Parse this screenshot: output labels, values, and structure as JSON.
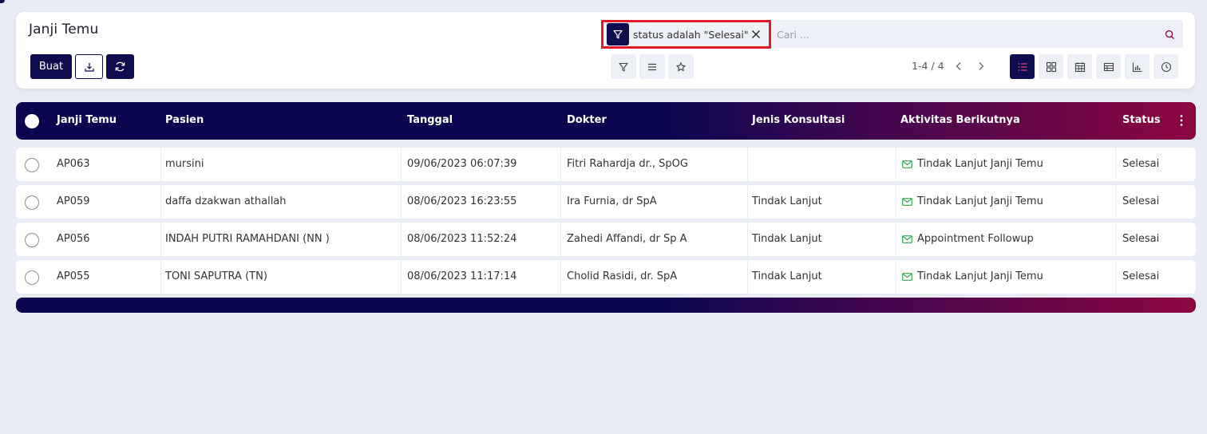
{
  "colors": {
    "primary": "#0e0b4f",
    "accent_end": "#8c0640",
    "highlight": "#e01b24",
    "activity_icon": "#2fa84f",
    "background": "#e9ebf5"
  },
  "header": {
    "title": "Janji Temu",
    "create_label": "Buat",
    "download_icon": "download-icon",
    "refresh_icon": "refresh-icon"
  },
  "search": {
    "facet_label": "status adalah \"Selesai\"",
    "placeholder": "Cari ..."
  },
  "pager": {
    "value": "1-4 / 4"
  },
  "table": {
    "columns": [
      "Janji Temu",
      "Pasien",
      "Tanggal",
      "Dokter",
      "Jenis Konsultasi",
      "Aktivitas Berikutnya",
      "Status"
    ],
    "rows": [
      {
        "id": "AP063",
        "pasien": "mursini",
        "tanggal": "09/06/2023 06:07:39",
        "dokter": "Fitri Rahardja dr., SpOG",
        "jenis": "",
        "aktivitas": "Tindak Lanjut Janji Temu",
        "status": "Selesai"
      },
      {
        "id": "AP059",
        "pasien": "daffa dzakwan athallah",
        "tanggal": "08/06/2023 16:23:55",
        "dokter": "Ira Furnia, dr SpA",
        "jenis": "Tindak Lanjut",
        "aktivitas": "Tindak Lanjut Janji Temu",
        "status": "Selesai"
      },
      {
        "id": "AP056",
        "pasien": "INDAH PUTRI RAMAHDANI (NN )",
        "tanggal": "08/06/2023 11:52:24",
        "dokter": "Zahedi Affandi, dr Sp A",
        "jenis": "Tindak Lanjut",
        "aktivitas": "Appointment Followup",
        "status": "Selesai"
      },
      {
        "id": "AP055",
        "pasien": "TONI SAPUTRA (TN)",
        "tanggal": "08/06/2023 11:17:14",
        "dokter": "Cholid Rasidi, dr. SpA",
        "jenis": "Tindak Lanjut",
        "aktivitas": "Tindak Lanjut Janji Temu",
        "status": "Selesai"
      }
    ]
  }
}
